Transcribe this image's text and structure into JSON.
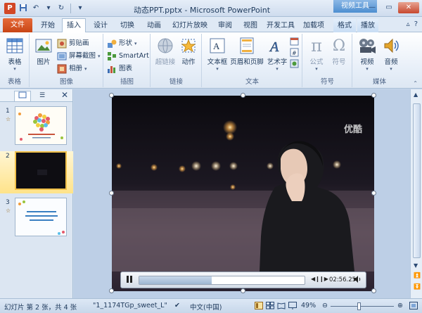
{
  "titlebar": {
    "title": "动态PPT.pptx - Microsoft PowerPoint",
    "context_tab": "视频工具",
    "app_icon": "P"
  },
  "tabs": {
    "file": "文件",
    "items": [
      "开始",
      "插入",
      "设计",
      "切换",
      "动画",
      "幻灯片放映",
      "审阅",
      "视图",
      "开发工具",
      "加载项",
      "格式",
      "播放"
    ],
    "active": "插入"
  },
  "ribbon": {
    "table": {
      "button": "表格",
      "group": "表格"
    },
    "image": {
      "picture": "图片",
      "clipart": "剪贴画",
      "screenshot": "屏幕截图",
      "album": "相册",
      "group": "图像"
    },
    "illustration": {
      "shapes": "形状",
      "smartart": "SmartArt",
      "chart": "图表",
      "group": "插图"
    },
    "links": {
      "hyperlink": "超链接",
      "action": "动作",
      "group": "链接"
    },
    "text": {
      "textbox": "文本框",
      "header_footer": "页眉和页脚",
      "wordart": "艺术字",
      "group": "文本"
    },
    "symbols": {
      "equation": "公式",
      "symbol": "符号",
      "group": "符号"
    },
    "media": {
      "video": "视频",
      "audio": "音频",
      "group": "媒体"
    }
  },
  "panel": {
    "tab_icons": [
      "slides-tab",
      "outline-tab"
    ],
    "slides": [
      {
        "num": "1",
        "anim": "☆",
        "selected": false
      },
      {
        "num": "2",
        "anim": "",
        "selected": true
      },
      {
        "num": "3",
        "anim": "☆",
        "selected": false
      }
    ]
  },
  "video": {
    "watermark": "优酷",
    "time": "02:56.25",
    "progress": 0.44
  },
  "status": {
    "slide_info": "幻灯片 第 2 张，共 4 张",
    "theme": "\"1_1174TGp_sweet_L\"",
    "language": "中文(中国)",
    "zoom": "49%"
  },
  "colors": {
    "file_tab": "#d24726",
    "context_tab": "#4d8ed0",
    "selected_thumb": "#f0c048"
  }
}
